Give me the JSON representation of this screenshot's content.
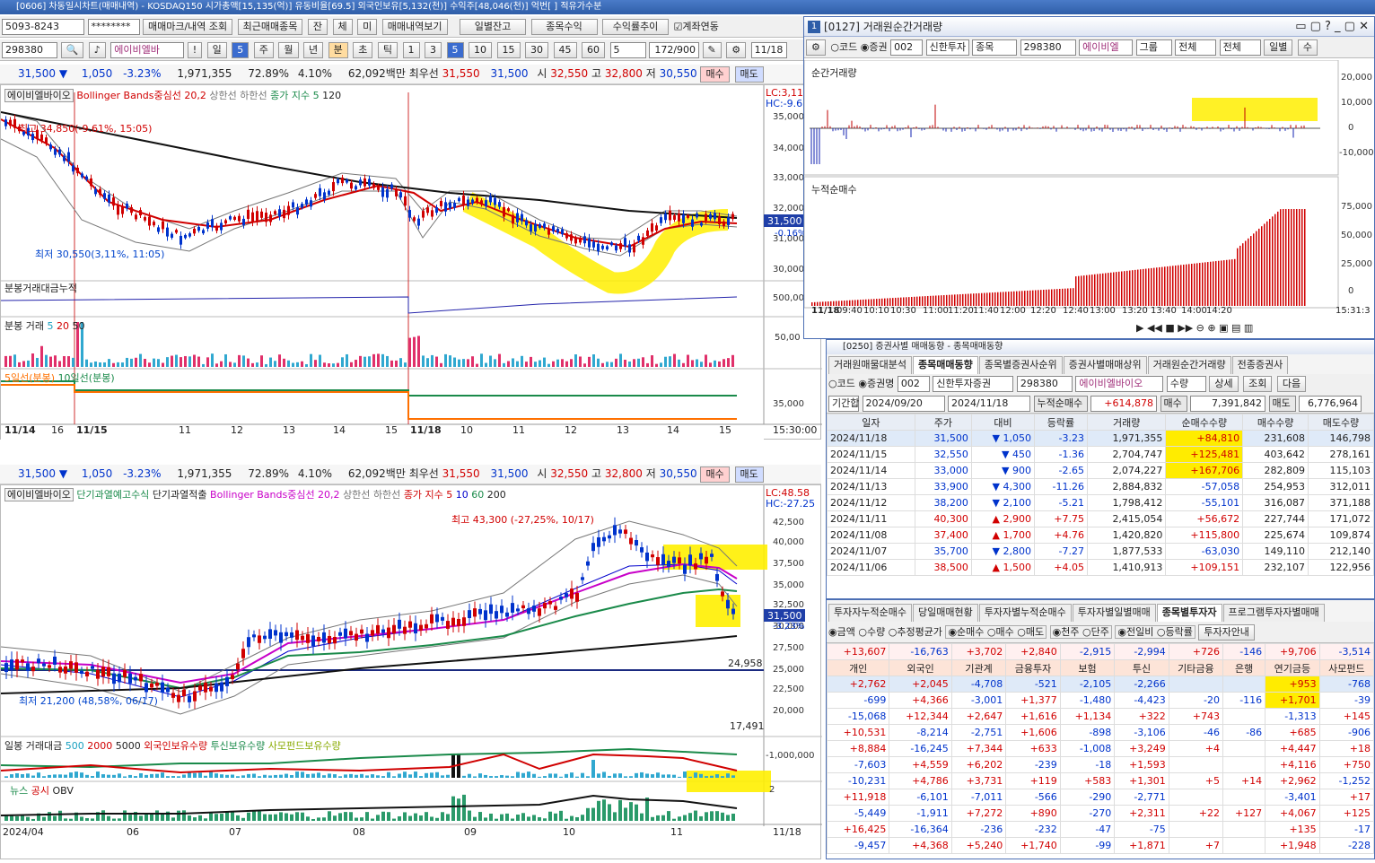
{
  "main_title": "[0606] 차동일시차트(매매내역) - KOSDAQ150 시가총액[15,135(억)] 유동비율[69.5] 외국인보유[5,132(천)] 수익주[48,046(천)] 억번[ ] 적유가수분",
  "toolbar1": {
    "account": "5093-8243",
    "password": "********",
    "b1": "매매마크/내역 조회",
    "b2": "최근매매종목",
    "b3": "잔",
    "b4": "체",
    "b5": "미",
    "b6": "매매내역보기",
    "b7": "일별잔고",
    "b8": "종목수익",
    "b9": "수익률추이",
    "b10": "계좌연동"
  },
  "toolbar2": {
    "code": "298380",
    "name": "에이비엘바",
    "period": "일",
    "n": "5",
    "p1": "주",
    "p2": "월",
    "p3": "년",
    "p4": "분",
    "p5": "초",
    "p6": "틱",
    "nums": [
      "1",
      "3",
      "5",
      "10",
      "15",
      "30",
      "45",
      "60"
    ],
    "interval": "5",
    "count": "172/900",
    "date": "11/18"
  },
  "price_line": {
    "price": "31,500",
    "arrow": "▼",
    "change": "1,050",
    "rate": "-3.23%",
    "volume": "1,971,355",
    "ratio": "72.89%",
    "pct": "4.10%",
    "amount": "62,092백만",
    "ask_label": "최우선",
    "ask": "31,550",
    "bid": "31,500",
    "open_label": "시",
    "open": "32,550",
    "high_label": "고",
    "high": "32,800",
    "low_label": "저",
    "low": "30,550",
    "buy": "매수",
    "sell": "매도"
  },
  "top_chart": {
    "legend_name": "에이비엘바이오",
    "legend_bb": "Bollinger Bands중심선 20,2",
    "legend_up": "상한선",
    "legend_dn": "하한선",
    "legend_close": "종가 지수 5",
    "legend_120": "120",
    "lc": "LC:3,11",
    "hc": "HC:-9.6",
    "high_note": "최고 34,850(-9.61%, 15:05)",
    "low_note": "최저 30,550(3,11%, 11:05)",
    "yticks": [
      "35,000",
      "34,000",
      "33,000",
      "32,000",
      "31,000",
      "30,000"
    ],
    "price_tag": "31,500",
    "price_pct": "-0.16%",
    "p2_label": "분봉거래대금누적",
    "p2_tick": "500,00",
    "p3_label": "분봉 거래",
    "p3_5": "5",
    "p3_20": "20",
    "p3_50": "50",
    "p3_tick": "50,00",
    "p4_label5": "5일선(분봉)",
    "p4_label10": "10일선(분봉)",
    "p4_tick": "35,000",
    "xlabels": [
      "11/14",
      "16",
      "11/15",
      "11",
      "12",
      "13",
      "14",
      "15",
      "11/18",
      "10",
      "11",
      "12",
      "13",
      "14",
      "15"
    ],
    "xend": "15:30:00"
  },
  "bottom_chart": {
    "legend_name": "에이비엘바이오",
    "leg2": "단기과열예고수식",
    "leg3": "단기과열적출",
    "legend_bb": "Bollinger Bands중심선 20,2",
    "legend_up": "상한선",
    "legend_dn": "하한선",
    "legend_close": "종가 지수 5",
    "l10": "10",
    "l60": "60",
    "l200": "200",
    "lc": "LC:48.58",
    "hc": "HC:-27.25",
    "high_note": "최고 43,300 (-27,25%, 10/17)",
    "low_note": "최저 21,200 (48,58%, 06/17)",
    "yticks": [
      "42,500",
      "40,000",
      "37,500",
      "35,000",
      "32,500",
      "30,000",
      "27,500",
      "25,000",
      "22,500",
      "20,000"
    ],
    "price_tag": "31,500",
    "price_pct": "-3.23%",
    "lvl1": "24,958",
    "lvl2": "17,491",
    "p2_label": "일봉 거래대금",
    "p2_500": "500",
    "p2_2000": "2000",
    "p2_5000": "5000",
    "p2_f": "외국인보유수량",
    "p2_t": "투신보유수량",
    "p2_s": "사모펀드보유수량",
    "p2_tick": "-1,000,000",
    "p3_news": "뉴스",
    "p3_pub": "공시",
    "p3_obv": "OBV",
    "p3_tick": "2",
    "xlabels": [
      "2024/04",
      "06",
      "07",
      "08",
      "09",
      "10",
      "11"
    ],
    "xend": "11/18"
  },
  "win1": {
    "title": "[0127] 거래원순간거래량",
    "code_radio": "코드",
    "sec_radio": "증권",
    "sec": "002",
    "broker": "신한투자",
    "kind": "종목",
    "code": "298380",
    "name": "에이비엘",
    "group": "그룹",
    "all1": "전체",
    "all2": "전체",
    "day": "일별",
    "su": "수",
    "p1_label": "순간거래량",
    "p1_ticks": [
      "20,000",
      "10,000",
      "0",
      "-10,000"
    ],
    "p2_label": "누적순매수",
    "p2_ticks": [
      "75,000",
      "50,000",
      "25,000",
      "0"
    ],
    "xlabels": [
      "11/18",
      "09:40",
      "10:10",
      "10:30",
      "11:00",
      "11:20",
      "11:40",
      "12:00",
      "12:20",
      "12:40",
      "13:00",
      "13:20",
      "13:40",
      "14:00",
      "14:20",
      "15:31:3"
    ]
  },
  "win2": {
    "title": "[0250] 증권사별 매매동향 - 종목매매동향",
    "tabs": [
      "거래원매물대분석",
      "종목매매동향",
      "종목별증권사순위",
      "증권사별매매상위",
      "거래원순간거래량",
      "전종증권사"
    ],
    "code_radio": "코드",
    "name_radio": "증권명",
    "sec": "002",
    "broker": "신한투자증권",
    "code": "298380",
    "name": "에이비엘바이오",
    "qty": "수량",
    "detail": "상세",
    "query": "조회",
    "next": "다음",
    "period_label": "기간합",
    "from": "2024/09/20",
    "to": "2024/11/18",
    "net_label": "누적순매수",
    "net": "+614,878",
    "buy_label": "매수",
    "buy": "7,391,842",
    "sell_label": "매도",
    "sell": "6,776,964",
    "cols": [
      "일자",
      "주가",
      "대비",
      "등락률",
      "거래량",
      "순매수수량",
      "매수수량",
      "매도수량"
    ],
    "rows": [
      [
        "2024/11/18",
        "31,500",
        "▼",
        "1,050",
        "-3.23",
        "1,971,355",
        "+84,810",
        "231,608",
        "146,798"
      ],
      [
        "2024/11/15",
        "32,550",
        "▼",
        "450",
        "-1.36",
        "2,704,747",
        "+125,481",
        "403,642",
        "278,161"
      ],
      [
        "2024/11/14",
        "33,000",
        "▼",
        "900",
        "-2.65",
        "2,074,227",
        "+167,706",
        "282,809",
        "115,103"
      ],
      [
        "2024/11/13",
        "33,900",
        "▼",
        "4,300",
        "-11.26",
        "2,884,832",
        "-57,058",
        "254,953",
        "312,011"
      ],
      [
        "2024/11/12",
        "38,200",
        "▼",
        "2,100",
        "-5.21",
        "1,798,412",
        "-55,101",
        "316,087",
        "371,188"
      ],
      [
        "2024/11/11",
        "40,300",
        "▲",
        "2,900",
        "+7.75",
        "2,415,054",
        "+56,672",
        "227,744",
        "171,072"
      ],
      [
        "2024/11/08",
        "37,400",
        "▲",
        "1,700",
        "+4.76",
        "1,420,820",
        "+115,800",
        "225,674",
        "109,874"
      ],
      [
        "2024/11/07",
        "35,700",
        "▼",
        "2,800",
        "-7.27",
        "1,877,533",
        "-63,030",
        "149,110",
        "212,140"
      ],
      [
        "2024/11/06",
        "38,500",
        "▲",
        "1,500",
        "+4.05",
        "1,410,913",
        "+109,151",
        "232,107",
        "122,956"
      ]
    ]
  },
  "win3": {
    "tabs": [
      "투자자누적순매수",
      "당일매매현황",
      "투자자별누적순매수",
      "투자자별일별매매",
      "종목별투자자",
      "프로그램투자자별매매"
    ],
    "radios": [
      "금액",
      "수량",
      "추정평균가",
      "순매수",
      "매수",
      "매도",
      "천주",
      "단주",
      "전일비",
      "등락률"
    ],
    "btn": "투자자안내",
    "cols": [
      "개인",
      "외국인",
      "기관계",
      "금융투자",
      "보험",
      "투신",
      "기타금융",
      "은행",
      "연기금등",
      "사모펀드"
    ],
    "sum": [
      "+13,607",
      "-16,763",
      "+3,702",
      "+2,840",
      "-2,915",
      "-2,994",
      "+726",
      "-146",
      "+9,706",
      "-3,514"
    ],
    "rows": [
      [
        "+2,762",
        "+2,045",
        "-4,708",
        "-521",
        "-2,105",
        "-2,266",
        "",
        "",
        "+953",
        "-768"
      ],
      [
        "-699",
        "+4,366",
        "-3,001",
        "+1,377",
        "-1,480",
        "-4,423",
        "-20",
        "-116",
        "+1,701",
        "-39"
      ],
      [
        "-15,068",
        "+12,344",
        "+2,647",
        "+1,616",
        "+1,134",
        "+322",
        "+743",
        "",
        "-1,313",
        "+145"
      ],
      [
        "+10,531",
        "-8,214",
        "-2,751",
        "+1,606",
        "-898",
        "-3,106",
        "-46",
        "-86",
        "+685",
        "-906"
      ],
      [
        "+8,884",
        "-16,245",
        "+7,344",
        "+633",
        "-1,008",
        "+3,249",
        "+4",
        "",
        "+4,447",
        "+18"
      ],
      [
        "-7,603",
        "+4,559",
        "+6,202",
        "-239",
        "-18",
        "+1,593",
        "",
        "",
        "+4,116",
        "+750"
      ],
      [
        "-10,231",
        "+4,786",
        "+3,731",
        "+119",
        "+583",
        "+1,301",
        "+5",
        "+14",
        "+2,962",
        "-1,252"
      ],
      [
        "+11,918",
        "-6,101",
        "-7,011",
        "-566",
        "-290",
        "-2,771",
        "",
        "",
        "-3,401",
        "+17"
      ],
      [
        "-5,449",
        "-1,911",
        "+7,272",
        "+890",
        "-270",
        "+2,311",
        "+22",
        "+127",
        "+4,067",
        "+125"
      ],
      [
        "+16,425",
        "-16,364",
        "-236",
        "-232",
        "-47",
        "-75",
        "",
        "",
        "+135",
        "-17"
      ],
      [
        "-9,457",
        "+4,368",
        "+5,240",
        "+1,740",
        "-99",
        "+1,871",
        "+7",
        "",
        "+1,948",
        "-228"
      ]
    ]
  },
  "colors": {
    "up": "#d10000",
    "down": "#0033cc",
    "highlight": "#ffec00"
  }
}
